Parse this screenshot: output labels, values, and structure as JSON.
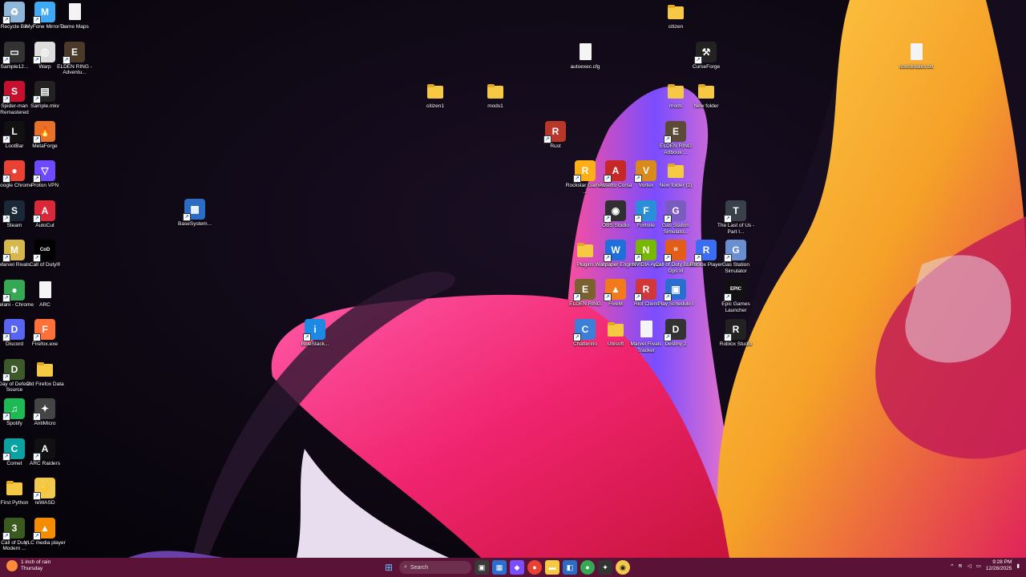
{
  "desktop": {
    "icons_left": [
      {
        "id": "recycle-bin",
        "label": "Recycle Bin",
        "kind": "app",
        "color": "#8fb5d9",
        "glyph": "♻"
      },
      {
        "id": "imyfone",
        "label": "iMyFone MirrorTo",
        "kind": "app",
        "color": "#3fa9f5",
        "glyph": "M"
      },
      {
        "id": "game-maps",
        "label": "Game Maps",
        "kind": "file"
      },
      {
        "id": "sample12",
        "label": "Sample12...",
        "kind": "app",
        "color": "#333",
        "glyph": "▭"
      },
      {
        "id": "warp",
        "label": "Warp",
        "kind": "app",
        "color": "#ddd",
        "glyph": "◎"
      },
      {
        "id": "elden-ring-adv",
        "label": "ELDEN RING - Adventu...",
        "kind": "app",
        "color": "#4a3a2a",
        "glyph": "E"
      },
      {
        "id": "spider-man",
        "label": "Spider-man Remastered",
        "kind": "app",
        "color": "#c8102e",
        "glyph": "S"
      },
      {
        "id": "sample-mkv",
        "label": "Sample.mkv",
        "kind": "app",
        "color": "#222",
        "glyph": "▤"
      },
      {
        "id": "lootbar",
        "label": "LootBar",
        "kind": "app",
        "color": "#111",
        "glyph": "L"
      },
      {
        "id": "metaforge",
        "label": "MetaForge",
        "kind": "app",
        "color": "#e8712a",
        "glyph": "🔥"
      },
      {
        "id": "google-chrome",
        "label": "Google Chrome",
        "kind": "app",
        "color": "#e94235",
        "glyph": "●"
      },
      {
        "id": "proton-vpn",
        "label": "Proton VPN",
        "kind": "app",
        "color": "#6d4aff",
        "glyph": "▽"
      },
      {
        "id": "steam",
        "label": "Steam",
        "kind": "app",
        "color": "#1b2838",
        "glyph": "S"
      },
      {
        "id": "autocut",
        "label": "AutoCut",
        "kind": "app",
        "color": "#d9283a",
        "glyph": "A"
      },
      {
        "id": "marvel-rivals",
        "label": "Marvel Rivals",
        "kind": "app",
        "color": "#d6b84a",
        "glyph": "M"
      },
      {
        "id": "call-of-duty",
        "label": "Call of Duty®",
        "kind": "app",
        "color": "#000",
        "glyph": "CoD"
      },
      {
        "id": "melani-chrome",
        "label": "Melani - Chrome",
        "kind": "app",
        "color": "#34a853",
        "glyph": "●"
      },
      {
        "id": "arc",
        "label": "ARC",
        "kind": "file"
      },
      {
        "id": "discord",
        "label": "Discord",
        "kind": "app",
        "color": "#5865f2",
        "glyph": "D"
      },
      {
        "id": "firefox-exe",
        "label": "Firefox.exe",
        "kind": "app",
        "color": "#ff7139",
        "glyph": "F"
      },
      {
        "id": "day-of-defeat",
        "label": "Day of Defeat Source",
        "kind": "app",
        "color": "#3c5a2a",
        "glyph": "D"
      },
      {
        "id": "old-firefox-data",
        "label": "Old Firefox Data",
        "kind": "folder"
      },
      {
        "id": "spotify",
        "label": "Spotify",
        "kind": "app",
        "color": "#1db954",
        "glyph": "♫"
      },
      {
        "id": "antimicro",
        "label": "AntiMicro",
        "kind": "app",
        "color": "#444",
        "glyph": "✦"
      },
      {
        "id": "comet",
        "label": "Comet",
        "kind": "app",
        "color": "#0aa3a3",
        "glyph": "C"
      },
      {
        "id": "arc-raiders",
        "label": "ARC Raiders",
        "kind": "app",
        "color": "#111",
        "glyph": "A"
      },
      {
        "id": "first-python",
        "label": "First Python",
        "kind": "folder"
      },
      {
        "id": "rewasd",
        "label": "reWASD",
        "kind": "app",
        "color": "#f2c94c",
        "glyph": "⚡"
      },
      {
        "id": "cod-modern",
        "label": "Call of Duty Modern ...",
        "kind": "app",
        "color": "#3b5b1e",
        "glyph": "3"
      },
      {
        "id": "vlc",
        "label": "VLC media player",
        "kind": "app",
        "color": "#f48b00",
        "glyph": "▲"
      }
    ],
    "icons_other": [
      {
        "id": "basesystem",
        "label": "BaseSystem...",
        "kind": "app",
        "color": "#2b6cc4",
        "glyph": "▦"
      },
      {
        "id": "citizen1",
        "label": "citizen1",
        "kind": "folder"
      },
      {
        "id": "mods1",
        "label": "mods1",
        "kind": "folder"
      },
      {
        "id": "autoexec-cfg",
        "label": "autoexec.cfg",
        "kind": "file"
      },
      {
        "id": "rust",
        "label": "Rust",
        "kind": "app",
        "color": "#b7372a",
        "glyph": "R"
      },
      {
        "id": "citizen",
        "label": "citizen",
        "kind": "folder"
      },
      {
        "id": "curseforge",
        "label": "CurseForge",
        "kind": "app",
        "color": "#222",
        "glyph": "⚒"
      },
      {
        "id": "mods",
        "label": "mods",
        "kind": "folder"
      },
      {
        "id": "new-folder",
        "label": "New folder",
        "kind": "folder"
      },
      {
        "id": "coordinates",
        "label": "coordinates.txt",
        "kind": "file"
      },
      {
        "id": "elden-ring-artbook",
        "label": "ELDEN RING Artbook ...",
        "kind": "app",
        "color": "#5a4a36",
        "glyph": "E"
      },
      {
        "id": "rockstar",
        "label": "Rockstar Games ...",
        "kind": "app",
        "color": "#fcaf17",
        "glyph": "R"
      },
      {
        "id": "assetto-corsa",
        "label": "Assetto Corsa",
        "kind": "app",
        "color": "#c62828",
        "glyph": "A"
      },
      {
        "id": "vortex",
        "label": "Vortex",
        "kind": "app",
        "color": "#d88a1a",
        "glyph": "V"
      },
      {
        "id": "new-folder-2",
        "label": "New folder (2)",
        "kind": "folder"
      },
      {
        "id": "obs",
        "label": "OBS Studio",
        "kind": "app",
        "color": "#302e31",
        "glyph": "◉"
      },
      {
        "id": "fortnite",
        "label": "Fortnite",
        "kind": "app",
        "color": "#2a8fd8",
        "glyph": "F"
      },
      {
        "id": "gas-station-sim-1",
        "label": "Gas Station Simulato...",
        "kind": "app",
        "color": "#7a5cc0",
        "glyph": "G"
      },
      {
        "id": "last-of-us",
        "label": "The Last of Us - Part I...",
        "kind": "app",
        "color": "#39424a",
        "glyph": "T"
      },
      {
        "id": "plugins",
        "label": "Plugins",
        "kind": "folder"
      },
      {
        "id": "wallpaper-engine",
        "label": "Wallpaper Engine",
        "kind": "app",
        "color": "#1e6fd9",
        "glyph": "W"
      },
      {
        "id": "nvidia-app",
        "label": "NVIDIA App",
        "kind": "app",
        "color": "#76b900",
        "glyph": "N"
      },
      {
        "id": "cod-bo3",
        "label": "Call of Duty Black Ops III",
        "kind": "app",
        "color": "#e35c18",
        "glyph": "III"
      },
      {
        "id": "roblox-player",
        "label": "Roblox Player",
        "kind": "app",
        "color": "#3b6cf4",
        "glyph": "R"
      },
      {
        "id": "gas-station-sim-2",
        "label": "Gas Station Simulator",
        "kind": "app",
        "color": "#6a8fd0",
        "glyph": "G"
      },
      {
        "id": "elden-ring",
        "label": "ELDEN RING",
        "kind": "app",
        "color": "#7a6230",
        "glyph": "E"
      },
      {
        "id": "fivem",
        "label": "FiveM",
        "kind": "app",
        "color": "#f27a1a",
        "glyph": "▲"
      },
      {
        "id": "riot-client",
        "label": "Riot Client",
        "kind": "app",
        "color": "#d13639",
        "glyph": "R"
      },
      {
        "id": "play-schedule",
        "label": "Play Schedule I",
        "kind": "app",
        "color": "#2a6fd0",
        "glyph": "▣"
      },
      {
        "id": "epic-games",
        "label": "Epic Games Launcher",
        "kind": "app",
        "color": "#111",
        "glyph": "EPIC"
      },
      {
        "id": "bluestacks",
        "label": "BlueStack...",
        "kind": "app",
        "color": "#1e88e5",
        "glyph": "i"
      },
      {
        "id": "chatterino",
        "label": "Chatterino",
        "kind": "app",
        "color": "#3b7fd9",
        "glyph": "C"
      },
      {
        "id": "ubisoft",
        "label": "Ubisoft",
        "kind": "folder"
      },
      {
        "id": "marvel-rivals-tracker",
        "label": "Marvel Rivals Tracker",
        "kind": "file"
      },
      {
        "id": "destiny-2",
        "label": "Destiny 2",
        "kind": "app",
        "color": "#333",
        "glyph": "D"
      },
      {
        "id": "roblox-studio",
        "label": "Roblox Studio",
        "kind": "app",
        "color": "#222",
        "glyph": "R"
      }
    ]
  },
  "taskbar": {
    "weather_line1": "1 inch of rain",
    "weather_line2": "Thursday",
    "search_placeholder": "Search",
    "time": "9:28 PM",
    "date": "12/28/2025"
  }
}
